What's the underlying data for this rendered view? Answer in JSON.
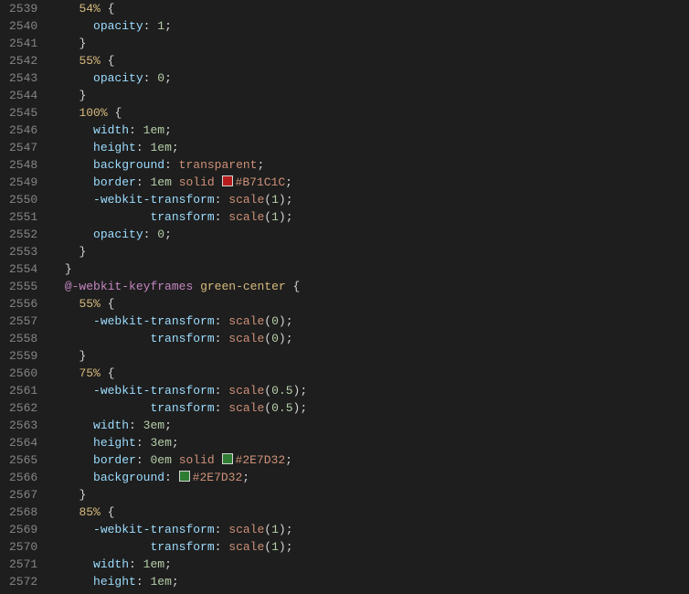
{
  "startLine": 2539,
  "lines": [
    [
      [
        "ind",
        4
      ],
      [
        "selector",
        "54%"
      ],
      [
        "ws",
        " "
      ],
      [
        "brace",
        "{"
      ]
    ],
    [
      [
        "ind",
        6
      ],
      [
        "prop",
        "opacity"
      ],
      [
        "punct",
        ":"
      ],
      [
        "ws",
        " "
      ],
      [
        "num",
        "1"
      ],
      [
        "punct",
        ";"
      ]
    ],
    [
      [
        "ind",
        4
      ],
      [
        "brace",
        "}"
      ]
    ],
    [
      [
        "ind",
        4
      ],
      [
        "selector",
        "55%"
      ],
      [
        "ws",
        " "
      ],
      [
        "brace",
        "{"
      ]
    ],
    [
      [
        "ind",
        6
      ],
      [
        "prop",
        "opacity"
      ],
      [
        "punct",
        ":"
      ],
      [
        "ws",
        " "
      ],
      [
        "num",
        "0"
      ],
      [
        "punct",
        ";"
      ]
    ],
    [
      [
        "ind",
        4
      ],
      [
        "brace",
        "}"
      ]
    ],
    [
      [
        "ind",
        4
      ],
      [
        "selector",
        "100%"
      ],
      [
        "ws",
        " "
      ],
      [
        "brace",
        "{"
      ]
    ],
    [
      [
        "ind",
        6
      ],
      [
        "prop",
        "width"
      ],
      [
        "punct",
        ":"
      ],
      [
        "ws",
        " "
      ],
      [
        "num",
        "1em"
      ],
      [
        "punct",
        ";"
      ]
    ],
    [
      [
        "ind",
        6
      ],
      [
        "prop",
        "height"
      ],
      [
        "punct",
        ":"
      ],
      [
        "ws",
        " "
      ],
      [
        "num",
        "1em"
      ],
      [
        "punct",
        ";"
      ]
    ],
    [
      [
        "ind",
        6
      ],
      [
        "prop",
        "background"
      ],
      [
        "punct",
        ":"
      ],
      [
        "ws",
        " "
      ],
      [
        "ident",
        "transparent"
      ],
      [
        "punct",
        ";"
      ]
    ],
    [
      [
        "ind",
        6
      ],
      [
        "prop",
        "border"
      ],
      [
        "punct",
        ":"
      ],
      [
        "ws",
        " "
      ],
      [
        "num",
        "1em"
      ],
      [
        "ws",
        " "
      ],
      [
        "ident",
        "solid"
      ],
      [
        "ws",
        " "
      ],
      [
        "swatch",
        "#B71C1C"
      ],
      [
        "color",
        "#B71C1C"
      ],
      [
        "punct",
        ";"
      ]
    ],
    [
      [
        "ind",
        6
      ],
      [
        "prop",
        "-webkit-transform"
      ],
      [
        "punct",
        ":"
      ],
      [
        "ws",
        " "
      ],
      [
        "ident",
        "scale"
      ],
      [
        "punct",
        "("
      ],
      [
        "num",
        "1"
      ],
      [
        "punct",
        ")"
      ],
      [
        "punct",
        ";"
      ]
    ],
    [
      [
        "ind",
        14
      ],
      [
        "prop",
        "transform"
      ],
      [
        "punct",
        ":"
      ],
      [
        "ws",
        " "
      ],
      [
        "ident",
        "scale"
      ],
      [
        "punct",
        "("
      ],
      [
        "num",
        "1"
      ],
      [
        "punct",
        ")"
      ],
      [
        "punct",
        ";"
      ]
    ],
    [
      [
        "ind",
        6
      ],
      [
        "prop",
        "opacity"
      ],
      [
        "punct",
        ":"
      ],
      [
        "ws",
        " "
      ],
      [
        "num",
        "0"
      ],
      [
        "punct",
        ";"
      ]
    ],
    [
      [
        "ind",
        4
      ],
      [
        "brace",
        "}"
      ]
    ],
    [
      [
        "ind",
        2
      ],
      [
        "brace",
        "}"
      ]
    ],
    [
      [
        "ind",
        2
      ],
      [
        "keyword",
        "@-webkit-keyframes"
      ],
      [
        "ws",
        " "
      ],
      [
        "name",
        "green-center"
      ],
      [
        "ws",
        " "
      ],
      [
        "brace",
        "{"
      ]
    ],
    [
      [
        "ind",
        4
      ],
      [
        "selector",
        "55%"
      ],
      [
        "ws",
        " "
      ],
      [
        "brace",
        "{"
      ]
    ],
    [
      [
        "ind",
        6
      ],
      [
        "prop",
        "-webkit-transform"
      ],
      [
        "punct",
        ":"
      ],
      [
        "ws",
        " "
      ],
      [
        "ident",
        "scale"
      ],
      [
        "punct",
        "("
      ],
      [
        "num",
        "0"
      ],
      [
        "punct",
        ")"
      ],
      [
        "punct",
        ";"
      ]
    ],
    [
      [
        "ind",
        14
      ],
      [
        "prop",
        "transform"
      ],
      [
        "punct",
        ":"
      ],
      [
        "ws",
        " "
      ],
      [
        "ident",
        "scale"
      ],
      [
        "punct",
        "("
      ],
      [
        "num",
        "0"
      ],
      [
        "punct",
        ")"
      ],
      [
        "punct",
        ";"
      ]
    ],
    [
      [
        "ind",
        4
      ],
      [
        "brace",
        "}"
      ]
    ],
    [
      [
        "ind",
        4
      ],
      [
        "selector",
        "75%"
      ],
      [
        "ws",
        " "
      ],
      [
        "brace",
        "{"
      ]
    ],
    [
      [
        "ind",
        6
      ],
      [
        "prop",
        "-webkit-transform"
      ],
      [
        "punct",
        ":"
      ],
      [
        "ws",
        " "
      ],
      [
        "ident",
        "scale"
      ],
      [
        "punct",
        "("
      ],
      [
        "num",
        "0.5"
      ],
      [
        "punct",
        ")"
      ],
      [
        "punct",
        ";"
      ]
    ],
    [
      [
        "ind",
        14
      ],
      [
        "prop",
        "transform"
      ],
      [
        "punct",
        ":"
      ],
      [
        "ws",
        " "
      ],
      [
        "ident",
        "scale"
      ],
      [
        "punct",
        "("
      ],
      [
        "num",
        "0.5"
      ],
      [
        "punct",
        ")"
      ],
      [
        "punct",
        ";"
      ]
    ],
    [
      [
        "ind",
        6
      ],
      [
        "prop",
        "width"
      ],
      [
        "punct",
        ":"
      ],
      [
        "ws",
        " "
      ],
      [
        "num",
        "3em"
      ],
      [
        "punct",
        ";"
      ]
    ],
    [
      [
        "ind",
        6
      ],
      [
        "prop",
        "height"
      ],
      [
        "punct",
        ":"
      ],
      [
        "ws",
        " "
      ],
      [
        "num",
        "3em"
      ],
      [
        "punct",
        ";"
      ]
    ],
    [
      [
        "ind",
        6
      ],
      [
        "prop",
        "border"
      ],
      [
        "punct",
        ":"
      ],
      [
        "ws",
        " "
      ],
      [
        "num",
        "0em"
      ],
      [
        "ws",
        " "
      ],
      [
        "ident",
        "solid"
      ],
      [
        "ws",
        " "
      ],
      [
        "swatch",
        "#2E7D32"
      ],
      [
        "color",
        "#2E7D32"
      ],
      [
        "punct",
        ";"
      ]
    ],
    [
      [
        "ind",
        6
      ],
      [
        "prop",
        "background"
      ],
      [
        "punct",
        ":"
      ],
      [
        "ws",
        " "
      ],
      [
        "swatch",
        "#2E7D32"
      ],
      [
        "color",
        "#2E7D32"
      ],
      [
        "punct",
        ";"
      ]
    ],
    [
      [
        "ind",
        4
      ],
      [
        "brace",
        "}"
      ]
    ],
    [
      [
        "ind",
        4
      ],
      [
        "selector",
        "85%"
      ],
      [
        "ws",
        " "
      ],
      [
        "brace",
        "{"
      ]
    ],
    [
      [
        "ind",
        6
      ],
      [
        "prop",
        "-webkit-transform"
      ],
      [
        "punct",
        ":"
      ],
      [
        "ws",
        " "
      ],
      [
        "ident",
        "scale"
      ],
      [
        "punct",
        "("
      ],
      [
        "num",
        "1"
      ],
      [
        "punct",
        ")"
      ],
      [
        "punct",
        ";"
      ]
    ],
    [
      [
        "ind",
        14
      ],
      [
        "prop",
        "transform"
      ],
      [
        "punct",
        ":"
      ],
      [
        "ws",
        " "
      ],
      [
        "ident",
        "scale"
      ],
      [
        "punct",
        "("
      ],
      [
        "num",
        "1"
      ],
      [
        "punct",
        ")"
      ],
      [
        "punct",
        ";"
      ]
    ],
    [
      [
        "ind",
        6
      ],
      [
        "prop",
        "width"
      ],
      [
        "punct",
        ":"
      ],
      [
        "ws",
        " "
      ],
      [
        "num",
        "1em"
      ],
      [
        "punct",
        ";"
      ]
    ],
    [
      [
        "ind",
        6
      ],
      [
        "prop",
        "height"
      ],
      [
        "punct",
        ":"
      ],
      [
        "ws",
        " "
      ],
      [
        "num",
        "1em"
      ],
      [
        "punct",
        ";"
      ]
    ]
  ]
}
